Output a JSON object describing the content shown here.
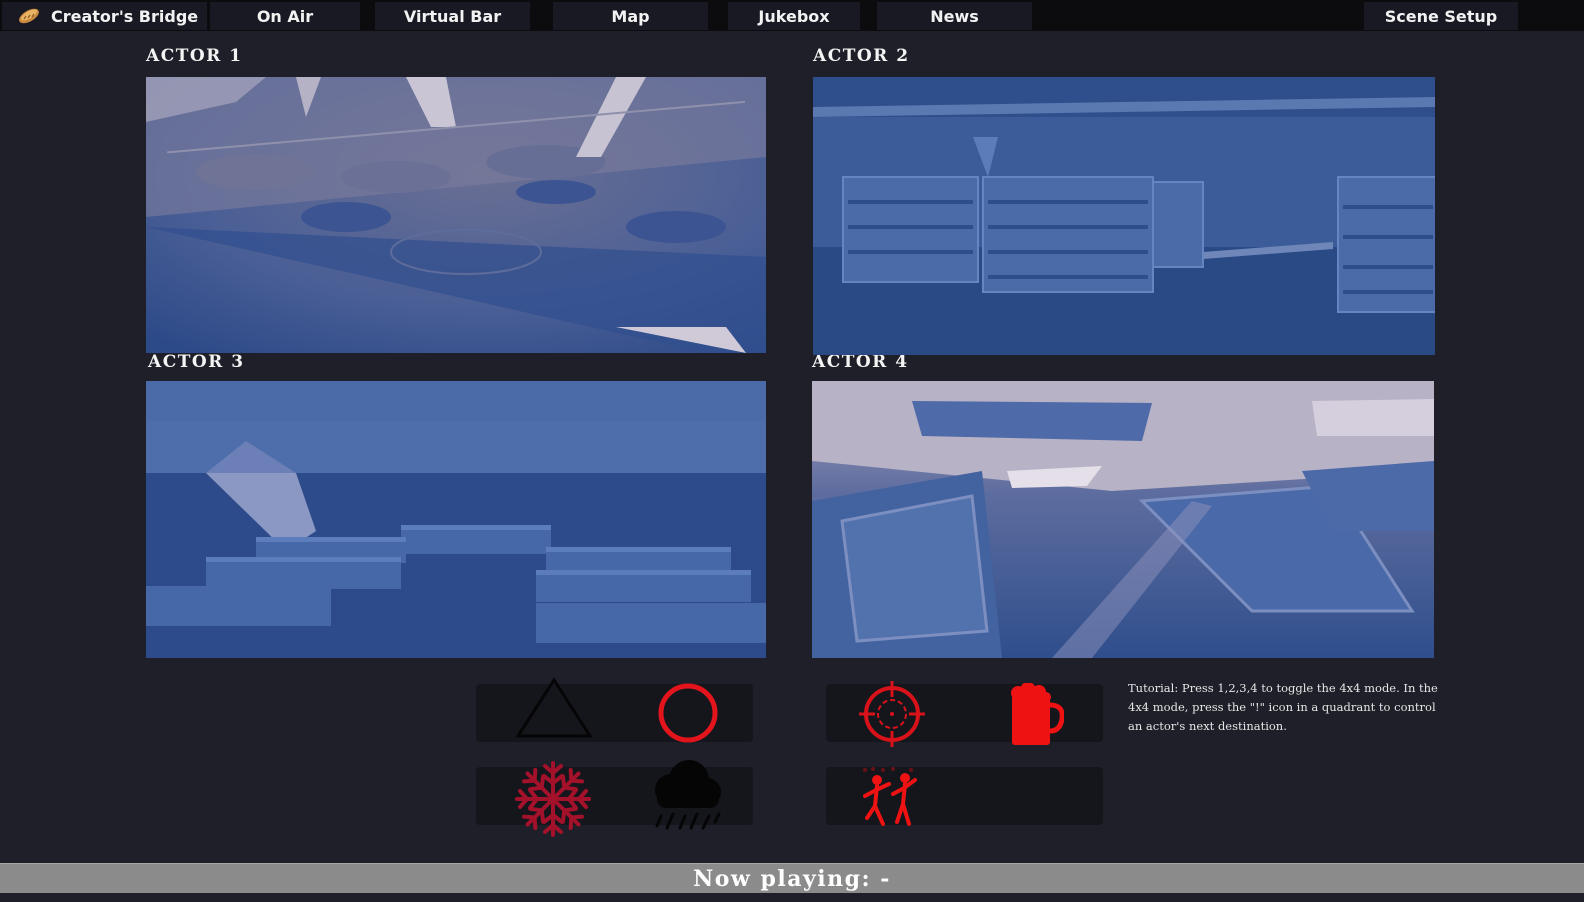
{
  "nav": {
    "brand_label": "Creator's Bridge",
    "brand_icon": "bread-icon",
    "items": [
      "On Air",
      "Virtual Bar",
      "Map",
      "Jukebox",
      "News"
    ],
    "scene_setup": "Scene Setup"
  },
  "actors": [
    {
      "label": "ACTOR 1"
    },
    {
      "label": "ACTOR 2"
    },
    {
      "label": "ACTOR 3"
    },
    {
      "label": "ACTOR 4"
    }
  ],
  "controls": {
    "left_panel": [
      "triangle-icon",
      "circle-icon",
      "snowflake-icon",
      "rain-cloud-icon"
    ],
    "right_panel": [
      "crosshair-icon",
      "beer-mug-icon",
      "dancing-people-icon"
    ]
  },
  "tutorial_text": "Tutorial: Press 1,2,3,4 to toggle the 4x4 mode. In the 4x4 mode, press the \"!\" icon in a quadrant to control an actor's next destination.",
  "now_playing": "Now playing: -",
  "colors": {
    "background": "#1e1f28",
    "nav_bar": "#0c0c0f",
    "nav_button": "#181922",
    "view_blue": "#3a5a94",
    "accent_red": "#e0141b",
    "snowflake_red": "#a3112a",
    "now_playing_bar": "#8b8b8b"
  }
}
